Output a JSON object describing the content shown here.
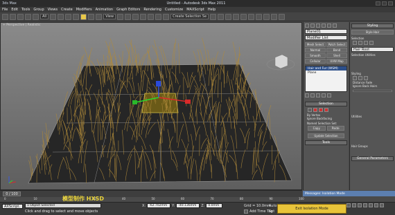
{
  "window": {
    "app_name": "3ds Max",
    "title": "Untitled - Autodesk 3ds Max 2011"
  },
  "menu": [
    "File",
    "Edit",
    "Tools",
    "Group",
    "Views",
    "Create",
    "Modifiers",
    "Animation",
    "Graph Editors",
    "Rendering",
    "Customize",
    "MAXScript",
    "Help"
  ],
  "toolbar": {
    "filter_value": "All",
    "view_value": "View",
    "selection_set_placeholder": "Create Selection Se"
  },
  "viewport": {
    "label": "+ Perspective | Realistic"
  },
  "modify_panel": {
    "object_name": "Plane01",
    "modifier_list_label": "Modifier List",
    "buttons": [
      "Mesh Select",
      "Patch Select",
      "Normal",
      "Bend",
      "Smooth",
      "Shell",
      "Cellular",
      "UVW Map"
    ],
    "stack": [
      {
        "label": "Hair and Fur (WSM)",
        "selected": true
      },
      {
        "label": "Plane",
        "selected": false
      }
    ],
    "selection_header": "Selection",
    "by_vertex_label": "By Vertex",
    "ignore_backfacing_label": "Ignore Backfacing",
    "named_selection_label": "Named Selection Set:",
    "copy_label": "Copy",
    "paste_label": "Paste",
    "update_selection_label": "Update Selection",
    "tools_header": "Tools"
  },
  "styling_panel": {
    "header": "Styling",
    "style_hair_label": "Style Hair",
    "selection_header": "Selection",
    "hair_root_label": "Hair Root",
    "selection_utilities_label": "Selection Utilities",
    "styling_header": "Styling",
    "distance_fade_label": "Distance Fade",
    "ignore_back_hairs_label": "Ignore Back Hairs",
    "utilities_header": "Utilities",
    "hair_groups_header": "Hair Groups",
    "general_params_header": "General Parameters"
  },
  "timeline": {
    "frame_display": "0 / 100",
    "ticks": [
      "0",
      "10",
      "20",
      "30",
      "40",
      "50",
      "60",
      "70",
      "80",
      "90",
      "100"
    ]
  },
  "watermark": "模型制作 HXSD",
  "status": {
    "script_label": "AXScript.",
    "selected_text": "1 Object Selected",
    "prompt_text": "Click and drag to select and move objects",
    "x_label": "X:",
    "x_value": "-62.702mm",
    "y_label": "Y:",
    "y_value": "-40.136mm",
    "z_label": "Z:",
    "z_value": "0.0mm",
    "grid_text": "Grid = 10.0mm",
    "auto_key_label": "Auto",
    "set_key_label": "Set",
    "add_time_tag_label": "Add Time Tag",
    "exit_isolation_label": "Exit Isolation Mode",
    "messages_label": "Messages: Isolation Mode"
  },
  "colors": {
    "grass": "#b08a3a",
    "ground": "#2a2a2a",
    "selection_yellow": "#d9c84a",
    "exit_button": "#e8c43a"
  }
}
